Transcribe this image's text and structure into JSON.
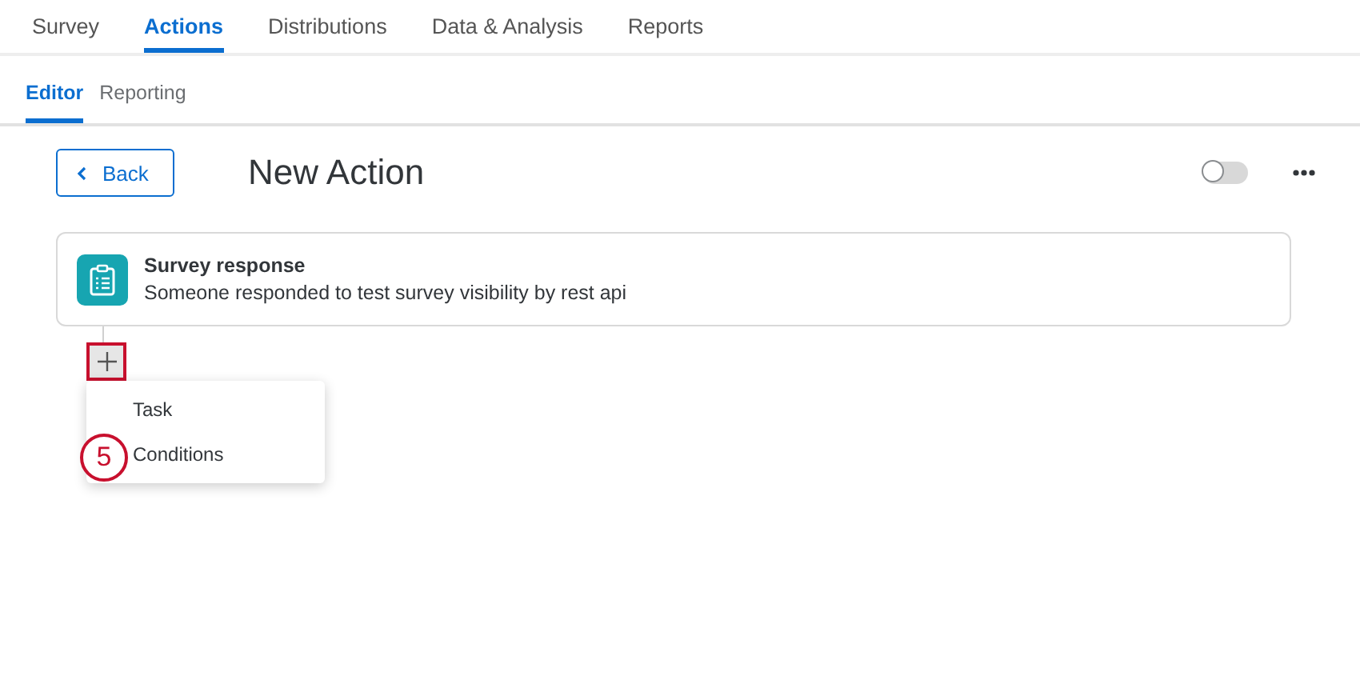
{
  "top_tabs": [
    {
      "label": "Survey",
      "selected": false
    },
    {
      "label": "Actions",
      "selected": true
    },
    {
      "label": "Distributions",
      "selected": false
    },
    {
      "label": "Data & Analysis",
      "selected": false
    },
    {
      "label": "Reports",
      "selected": false
    }
  ],
  "sub_tabs": [
    {
      "label": "Editor",
      "selected": true
    },
    {
      "label": "Reporting",
      "selected": false
    }
  ],
  "header": {
    "back_button": "Back",
    "title": "New Action",
    "enabled_toggle": {
      "on": false
    }
  },
  "trigger_card": {
    "title": "Survey response",
    "description": "Someone responded to test survey visibility by rest api"
  },
  "add_menu": {
    "highlighted": true,
    "items": [
      {
        "label": "Task"
      },
      {
        "label": "Conditions"
      }
    ]
  },
  "step_badge": "5"
}
